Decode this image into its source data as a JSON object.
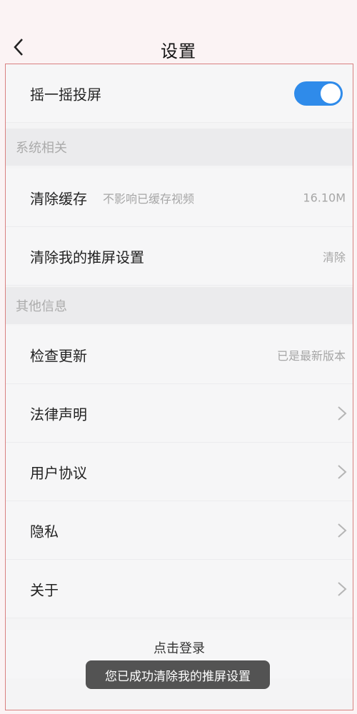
{
  "header": {
    "title": "设置"
  },
  "toggle_row": {
    "label": "摇一摇投屏",
    "enabled": true
  },
  "sections": {
    "system": "系统相关",
    "other": "其他信息"
  },
  "clear_cache": {
    "label": "清除缓存",
    "sub": "不影响已缓存视频",
    "value": "16.10M"
  },
  "clear_screen": {
    "label": "清除我的推屏设置",
    "action": "清除"
  },
  "check_update": {
    "label": "检查更新",
    "value": "已是最新版本"
  },
  "menu": {
    "legal": "法律声明",
    "agreement": "用户协议",
    "privacy": "隐私",
    "about": "关于"
  },
  "login": {
    "label": "点击登录"
  },
  "toast": {
    "text": "您已成功清除我的推屏设置"
  },
  "colors": {
    "accent": "#2f8bea",
    "frame": "#d98080"
  }
}
